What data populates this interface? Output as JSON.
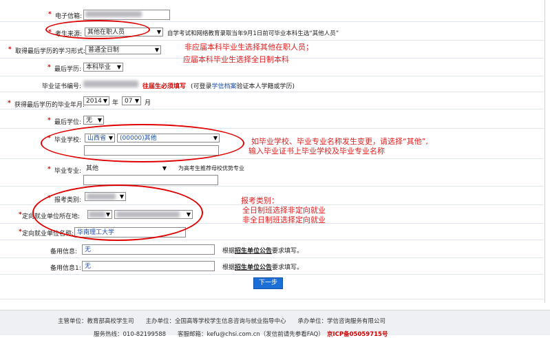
{
  "form": {
    "email": {
      "label": "电子信箱:",
      "value": ""
    },
    "source": {
      "label": "考生来源:",
      "value": "其他在职人员",
      "note": "自学考试和网络教育录取当年9月1日前可毕业本科生选“其他人员”"
    },
    "study_form": {
      "label": "取得最后学历的学习形式:",
      "value": "普通全日制"
    },
    "last_degree_edu": {
      "label": "最后学历:",
      "value": "本科毕业"
    },
    "cert_no": {
      "label": "毕业证书编号:",
      "note_red": "往届生必须填写",
      "note_pre": "(可登录",
      "note_link": "学信档案",
      "note_post": "验证本人学籍或学历)"
    },
    "grad_date": {
      "label": "获得最后学历的毕业年月:",
      "year": "2014",
      "year_unit": "年",
      "month": "07",
      "month_unit": "月"
    },
    "last_degree": {
      "label": "最后学位:",
      "value": "无"
    },
    "school": {
      "label": "毕业学校:",
      "province": "山西省",
      "value": "(00000)其他"
    },
    "major": {
      "label": "毕业专业:",
      "value": "其他",
      "note": "为高考生推荐母校优势专业"
    },
    "exam_type": {
      "label": "报考类别:"
    },
    "directed_location": {
      "label": "定向就业单位所在地:"
    },
    "directed_unit": {
      "label": "定向就业单位名称:",
      "value": "华南理工大学"
    },
    "spare1": {
      "label": "备用信息:",
      "value": "无",
      "note_pre": "根据",
      "note_link": "招生单位公告",
      "note_post": "要求填写。"
    },
    "spare2": {
      "label": "备用信息1:",
      "value": "无",
      "note_pre": "根据",
      "note_link": "招生单位公告",
      "note_post": "要求填写。"
    },
    "next_button": "下一步"
  },
  "annotations": {
    "note1_line1": "非应届本科毕业生选择其他在职人员；",
    "note1_line2": "应届本科毕业生选择全日制本科",
    "note2_line1": "如毕业学校、毕业专业名称发生变更，请选择“其他”,",
    "note2_line2": "输入毕业证书上毕业学校及毕业专业名称",
    "note3_line1": "报考类别：",
    "note3_line2": "全日制班选择非定向就业",
    "note3_line3": "非全日制班选择定向就业"
  },
  "footer": {
    "line1": "主管单位：教育部高校学生司　　主办单位：全国高等学校学生信息咨询与就业指导中心　　承办单位：学信咨询服务有限公司",
    "line2_part1": "服务热线：010-82199588　　客服邮箱：kefu@chsi.com.cn（发信前请先参看FAQ）",
    "line2_icp": "京ICP备05059715号"
  },
  "colors": {
    "annotation_red": "#e02020",
    "ellipse_red": "#e00000",
    "button_blue": "#1b6fd6",
    "link_blue": "#1d4ea8"
  }
}
